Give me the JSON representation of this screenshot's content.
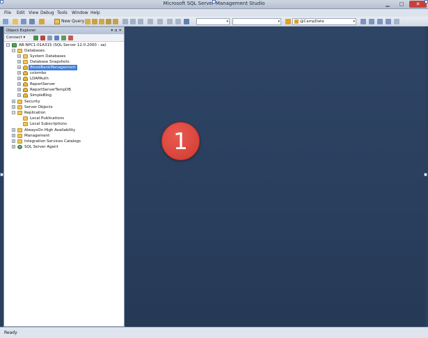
{
  "window": {
    "title": "Microsoft SQL Server Management Studio"
  },
  "menu": [
    "File",
    "Edit",
    "View",
    "Debug",
    "Tools",
    "Window",
    "Help"
  ],
  "toolbar": {
    "new_query_label": "New Query",
    "database_combo_value": "@CampDate"
  },
  "object_explorer": {
    "title": "Object Explorer",
    "header_buttons": "▾ ⊐ ✕",
    "connect_label": "Connect ▾",
    "tree": [
      {
        "label": "AB-NPC1-01A315 (SQL Server 12.0.2000 - sa)",
        "expanded": "−"
      },
      {
        "label": "Databases",
        "expanded": "−"
      },
      {
        "label": "System Databases",
        "expanded": "+"
      },
      {
        "label": "Database Snapshots",
        "expanded": "+"
      },
      {
        "label": "BloodBankManagement",
        "expanded": "+"
      },
      {
        "label": "colombo",
        "expanded": "+"
      },
      {
        "label": "LDAPAuth",
        "expanded": "+"
      },
      {
        "label": "ReportServer",
        "expanded": "+"
      },
      {
        "label": "ReportServerTempDB",
        "expanded": "+"
      },
      {
        "label": "SimpleBlog",
        "expanded": "+"
      },
      {
        "label": "Security",
        "expanded": "+"
      },
      {
        "label": "Server Objects",
        "expanded": "+"
      },
      {
        "label": "Replication",
        "expanded": "−"
      },
      {
        "label": "Local Publications",
        "expanded": ""
      },
      {
        "label": "Local Subscriptions",
        "expanded": ""
      },
      {
        "label": "AlwaysOn High Availability",
        "expanded": "+"
      },
      {
        "label": "Management",
        "expanded": "+"
      },
      {
        "label": "Integration Services Catalogs",
        "expanded": "+"
      },
      {
        "label": "SQL Server Agent",
        "expanded": "+"
      }
    ]
  },
  "callout": {
    "number": "1"
  },
  "status": {
    "text": "Ready"
  },
  "colors": {
    "accent": "#3c7fd9",
    "background": "#2b3f5e",
    "callout": "#cf3a33"
  }
}
